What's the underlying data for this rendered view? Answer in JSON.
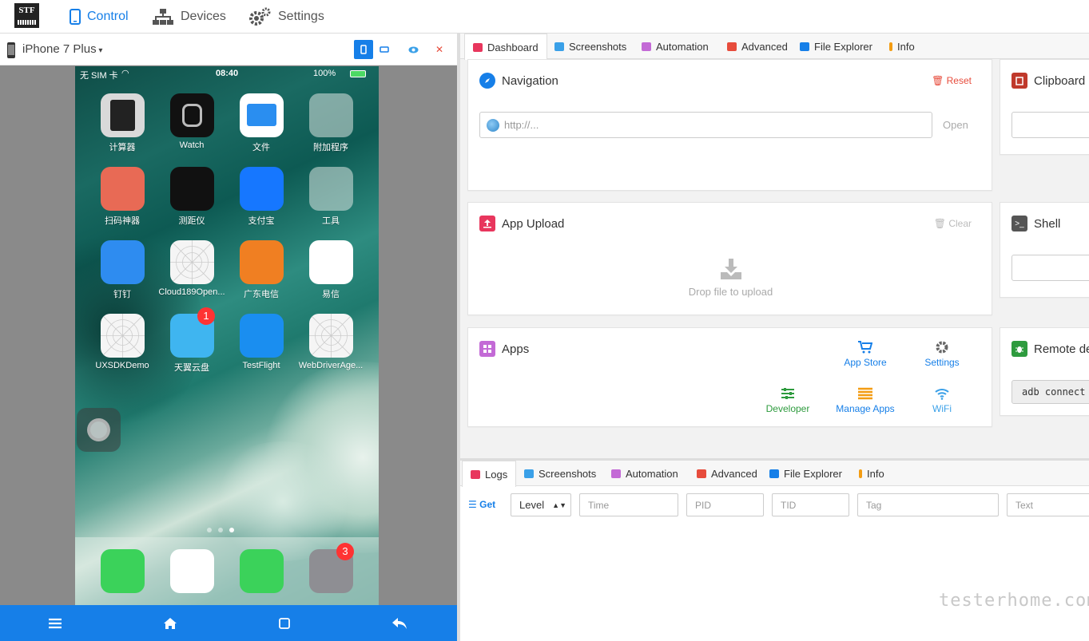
{
  "nav": {
    "logo": "STF",
    "control": "Control",
    "devices": "Devices",
    "settings": "Settings"
  },
  "device": {
    "name": "iPhone 7 Plus",
    "status": {
      "carrier": "无 SIM 卡",
      "time": "08:40",
      "battery": "100%"
    },
    "apps": [
      {
        "label": "计算器",
        "icon": "calculator-icon"
      },
      {
        "label": "Watch",
        "icon": "watch-icon"
      },
      {
        "label": "文件",
        "icon": "files-icon"
      },
      {
        "label": "附加程序",
        "icon": "folder-icon"
      },
      {
        "label": "扫码神器",
        "icon": "barcode-icon"
      },
      {
        "label": "测距仪",
        "icon": "measure-icon"
      },
      {
        "label": "支付宝",
        "icon": "alipay-icon"
      },
      {
        "label": "工具",
        "icon": "folder-icon"
      },
      {
        "label": "钉钉",
        "icon": "dingtalk-icon"
      },
      {
        "label": "Cloud189Open...",
        "icon": "placeholder-app-icon"
      },
      {
        "label": "广东电信",
        "icon": "telecom-icon"
      },
      {
        "label": "易信",
        "icon": "yixin-icon"
      },
      {
        "label": "UXSDKDemo",
        "icon": "placeholder-app-icon"
      },
      {
        "label": "天翼云盘",
        "icon": "cloud-icon",
        "badge": "1"
      },
      {
        "label": "TestFlight",
        "icon": "testflight-icon"
      },
      {
        "label": "WebDriverAge...",
        "icon": "placeholder-app-icon"
      }
    ],
    "dock": [
      {
        "icon": "phone-icon"
      },
      {
        "icon": "safari-icon"
      },
      {
        "icon": "messages-icon"
      },
      {
        "icon": "settings-app-icon",
        "badge": "3"
      }
    ]
  },
  "tabs": [
    "Dashboard",
    "Screenshots",
    "Automation",
    "Advanced",
    "File Explorer",
    "Info"
  ],
  "navigation": {
    "title": "Navigation",
    "reset": "Reset",
    "placeholder": "http://...",
    "open": "Open"
  },
  "clipboard": {
    "title": "Clipboard"
  },
  "upload": {
    "title": "App Upload",
    "clear": "Clear",
    "drop": "Drop file to upload"
  },
  "shell": {
    "title": "Shell"
  },
  "apps_card": {
    "title": "Apps",
    "buttons": [
      "App Store",
      "Settings",
      "Developer",
      "Manage Apps",
      "WiFi"
    ]
  },
  "remote": {
    "title": "Remote de",
    "cmd": "adb connect"
  },
  "logtabs": [
    "Logs",
    "Screenshots",
    "Automation",
    "Advanced",
    "File Explorer",
    "Info"
  ],
  "logs": {
    "get": "Get",
    "level": "Level",
    "time": "Time",
    "pid": "PID",
    "tid": "TID",
    "tag": "Tag",
    "text": "Text"
  },
  "watermark": "testerhome.com",
  "colors": {
    "accent": "#167fe8",
    "danger": "#e74c3c"
  }
}
